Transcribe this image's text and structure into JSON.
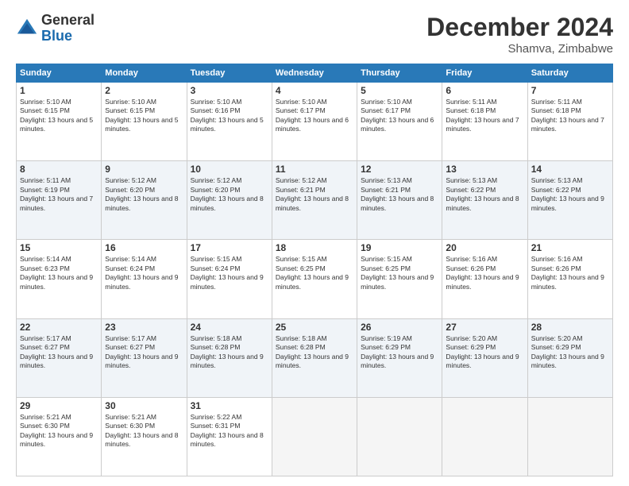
{
  "logo": {
    "general": "General",
    "blue": "Blue"
  },
  "header": {
    "month": "December 2024",
    "location": "Shamva, Zimbabwe"
  },
  "days_of_week": [
    "Sunday",
    "Monday",
    "Tuesday",
    "Wednesday",
    "Thursday",
    "Friday",
    "Saturday"
  ],
  "weeks": [
    [
      {
        "day": "1",
        "sunrise": "5:10 AM",
        "sunset": "6:15 PM",
        "daylight": "13 hours and 5 minutes."
      },
      {
        "day": "2",
        "sunrise": "5:10 AM",
        "sunset": "6:15 PM",
        "daylight": "13 hours and 5 minutes."
      },
      {
        "day": "3",
        "sunrise": "5:10 AM",
        "sunset": "6:16 PM",
        "daylight": "13 hours and 5 minutes."
      },
      {
        "day": "4",
        "sunrise": "5:10 AM",
        "sunset": "6:17 PM",
        "daylight": "13 hours and 6 minutes."
      },
      {
        "day": "5",
        "sunrise": "5:10 AM",
        "sunset": "6:17 PM",
        "daylight": "13 hours and 6 minutes."
      },
      {
        "day": "6",
        "sunrise": "5:11 AM",
        "sunset": "6:18 PM",
        "daylight": "13 hours and 7 minutes."
      },
      {
        "day": "7",
        "sunrise": "5:11 AM",
        "sunset": "6:18 PM",
        "daylight": "13 hours and 7 minutes."
      }
    ],
    [
      {
        "day": "8",
        "sunrise": "5:11 AM",
        "sunset": "6:19 PM",
        "daylight": "13 hours and 7 minutes."
      },
      {
        "day": "9",
        "sunrise": "5:12 AM",
        "sunset": "6:20 PM",
        "daylight": "13 hours and 8 minutes."
      },
      {
        "day": "10",
        "sunrise": "5:12 AM",
        "sunset": "6:20 PM",
        "daylight": "13 hours and 8 minutes."
      },
      {
        "day": "11",
        "sunrise": "5:12 AM",
        "sunset": "6:21 PM",
        "daylight": "13 hours and 8 minutes."
      },
      {
        "day": "12",
        "sunrise": "5:13 AM",
        "sunset": "6:21 PM",
        "daylight": "13 hours and 8 minutes."
      },
      {
        "day": "13",
        "sunrise": "5:13 AM",
        "sunset": "6:22 PM",
        "daylight": "13 hours and 8 minutes."
      },
      {
        "day": "14",
        "sunrise": "5:13 AM",
        "sunset": "6:22 PM",
        "daylight": "13 hours and 9 minutes."
      }
    ],
    [
      {
        "day": "15",
        "sunrise": "5:14 AM",
        "sunset": "6:23 PM",
        "daylight": "13 hours and 9 minutes."
      },
      {
        "day": "16",
        "sunrise": "5:14 AM",
        "sunset": "6:24 PM",
        "daylight": "13 hours and 9 minutes."
      },
      {
        "day": "17",
        "sunrise": "5:15 AM",
        "sunset": "6:24 PM",
        "daylight": "13 hours and 9 minutes."
      },
      {
        "day": "18",
        "sunrise": "5:15 AM",
        "sunset": "6:25 PM",
        "daylight": "13 hours and 9 minutes."
      },
      {
        "day": "19",
        "sunrise": "5:15 AM",
        "sunset": "6:25 PM",
        "daylight": "13 hours and 9 minutes."
      },
      {
        "day": "20",
        "sunrise": "5:16 AM",
        "sunset": "6:26 PM",
        "daylight": "13 hours and 9 minutes."
      },
      {
        "day": "21",
        "sunrise": "5:16 AM",
        "sunset": "6:26 PM",
        "daylight": "13 hours and 9 minutes."
      }
    ],
    [
      {
        "day": "22",
        "sunrise": "5:17 AM",
        "sunset": "6:27 PM",
        "daylight": "13 hours and 9 minutes."
      },
      {
        "day": "23",
        "sunrise": "5:17 AM",
        "sunset": "6:27 PM",
        "daylight": "13 hours and 9 minutes."
      },
      {
        "day": "24",
        "sunrise": "5:18 AM",
        "sunset": "6:28 PM",
        "daylight": "13 hours and 9 minutes."
      },
      {
        "day": "25",
        "sunrise": "5:18 AM",
        "sunset": "6:28 PM",
        "daylight": "13 hours and 9 minutes."
      },
      {
        "day": "26",
        "sunrise": "5:19 AM",
        "sunset": "6:29 PM",
        "daylight": "13 hours and 9 minutes."
      },
      {
        "day": "27",
        "sunrise": "5:20 AM",
        "sunset": "6:29 PM",
        "daylight": "13 hours and 9 minutes."
      },
      {
        "day": "28",
        "sunrise": "5:20 AM",
        "sunset": "6:29 PM",
        "daylight": "13 hours and 9 minutes."
      }
    ],
    [
      {
        "day": "29",
        "sunrise": "5:21 AM",
        "sunset": "6:30 PM",
        "daylight": "13 hours and 9 minutes."
      },
      {
        "day": "30",
        "sunrise": "5:21 AM",
        "sunset": "6:30 PM",
        "daylight": "13 hours and 8 minutes."
      },
      {
        "day": "31",
        "sunrise": "5:22 AM",
        "sunset": "6:31 PM",
        "daylight": "13 hours and 8 minutes."
      },
      null,
      null,
      null,
      null
    ]
  ],
  "labels": {
    "sunrise": "Sunrise:",
    "sunset": "Sunset:",
    "daylight": "Daylight:"
  }
}
